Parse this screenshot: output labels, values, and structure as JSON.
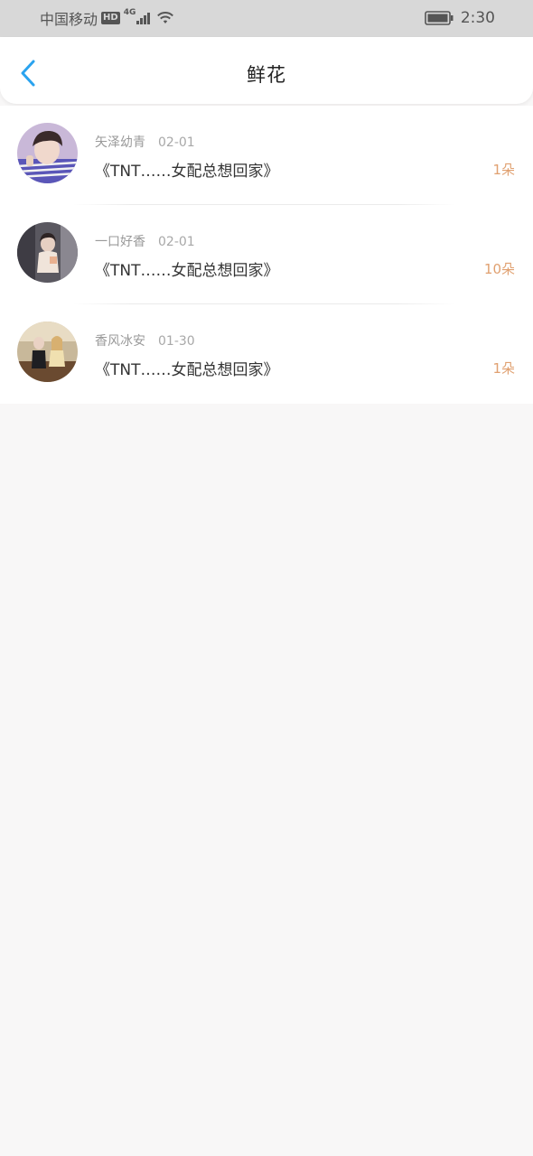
{
  "status_bar": {
    "carrier": "中国移动",
    "hd_badge": "HD",
    "network_type": "4G",
    "time": "2:30"
  },
  "header": {
    "title": "鲜花",
    "back_icon": "chevron-left-icon",
    "accent_color": "#2aa3ef"
  },
  "list": {
    "items": [
      {
        "username": "矢泽幼青",
        "date": "02-01",
        "book_title": "《TNT……女配总想回家》",
        "count": "1朵"
      },
      {
        "username": "一口好香",
        "date": "02-01",
        "book_title": "《TNT……女配总想回家》",
        "count": "10朵"
      },
      {
        "username": "香风冰安",
        "date": "01-30",
        "book_title": "《TNT……女配总想回家》",
        "count": "1朵"
      }
    ]
  },
  "colors": {
    "status_bar_bg": "#d8d8d8",
    "page_bg": "#f8f7f7",
    "count_color": "#e0a070"
  }
}
